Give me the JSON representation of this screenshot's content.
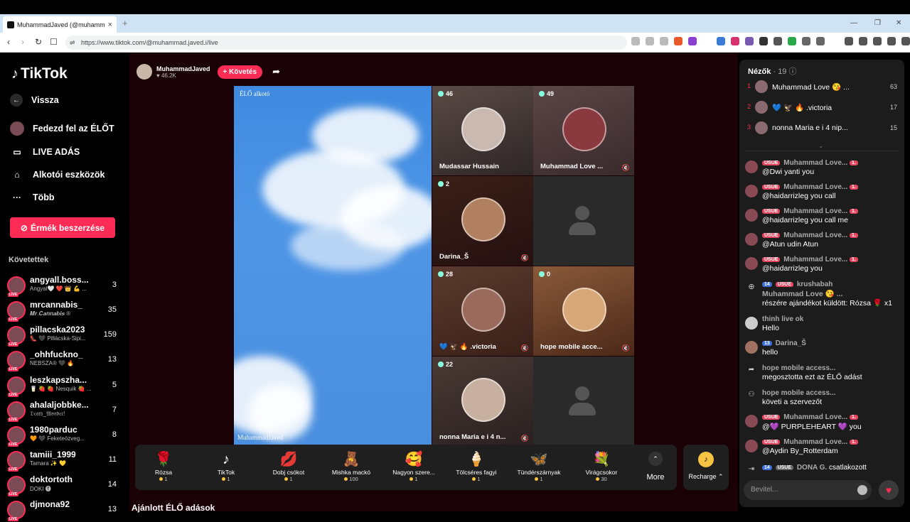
{
  "browser": {
    "tab_title": "MuhammadJaved (@muhamm",
    "url": "https://www.tiktok.com/@muhammad.javed.i/live"
  },
  "sidebar": {
    "logo": "TikTok",
    "back": "Vissza",
    "discover_live": "Fedezd fel az ÉLŐT",
    "live_stream": "LIVE ADÁS",
    "creator_tools": "Alkotói eszközök",
    "more": "Több",
    "buy_coins": "Érmék beszerzése",
    "followed_title": "Követettek",
    "followed": [
      {
        "name": "angyall.boss...",
        "sub": "Angyal🤍 ❤️ 👑 💪 ...",
        "count": "3"
      },
      {
        "name": "mrcannabis_",
        "sub": "𝑴𝒓.𝑪𝒂𝒏𝒏𝒂𝒃𝒊𝒔 ®",
        "count": "35"
      },
      {
        "name": "pillacska2023",
        "sub": "👠 🖤 Pillácska-Sipi...",
        "count": "159"
      },
      {
        "name": "_ohhfuckno_",
        "sub": "NEBSZA® 🖤 🔥",
        "count": "13"
      },
      {
        "name": "leszkapszha...",
        "sub": "🥛 🍓 🍓 Nesquik 🍓 ...",
        "count": "5"
      },
      {
        "name": "ahalaljobbke...",
        "sub": "𝔇𝔢𝔞𝔱𝔥_𝔚𝔬𝔫𝔡𝔢𝔯!",
        "count": "7"
      },
      {
        "name": "1980parduc",
        "sub": "🧡 🖤 Feketeözveg...",
        "count": "8"
      },
      {
        "name": "tamiii_1999",
        "sub": "Tamara ✨ 💛",
        "count": "11"
      },
      {
        "name": "doktortoth",
        "sub": "DOKI 🅣",
        "count": "14"
      },
      {
        "name": "djmona92",
        "sub": "",
        "count": "13"
      }
    ]
  },
  "host": {
    "name": "MuhammadJaved",
    "likes": "46.2K",
    "follow_label": "+ Követés"
  },
  "stage": {
    "creator_label": "ÉLŐ alkotó",
    "host_label": "MuhammadJaved",
    "guests": [
      {
        "name": "Mudassar Hussain",
        "count": "46"
      },
      {
        "name": "Muhammad Love ...",
        "count": "49"
      },
      {
        "name": "Darina_Š",
        "count": "2"
      },
      {
        "name": "",
        "count": ""
      },
      {
        "name": "💙 🦅 🔥 .victoria",
        "count": "28"
      },
      {
        "name": "hope mobile acce...",
        "count": "0"
      },
      {
        "name": "nonna Maria e i 4 n...",
        "count": "22"
      },
      {
        "name": "",
        "count": ""
      }
    ]
  },
  "gifts": [
    {
      "icon": "🌹",
      "name": "Rózsa",
      "price": "1"
    },
    {
      "icon": "♪",
      "name": "TikTok",
      "price": "1"
    },
    {
      "icon": "💋",
      "name": "Dobj csókot",
      "price": "1"
    },
    {
      "icon": "🧸",
      "name": "Mishka mackó",
      "price": "100"
    },
    {
      "icon": "🥰",
      "name": "Nagyon szere...",
      "price": "1"
    },
    {
      "icon": "🍦",
      "name": "Tölcséres fagyi",
      "price": "1"
    },
    {
      "icon": "🦋",
      "name": "Tündérszárnyak",
      "price": "1"
    },
    {
      "icon": "💐",
      "name": "Virágcsokor",
      "price": "30"
    }
  ],
  "more_label": "More",
  "recharge_label": "Recharge",
  "recommended_title": "Ajánlott ÉLŐ adások",
  "viewers": {
    "title": "Nézők",
    "count": "· 19",
    "top": [
      {
        "rank": "1",
        "name": "Muhammad Love 😘 ...",
        "score": "63"
      },
      {
        "rank": "2",
        "name": "💙 🦅 🔥 .victoria",
        "score": "17"
      },
      {
        "rank": "3",
        "name": "nonna Maria e i 4 nip...",
        "score": "15"
      }
    ]
  },
  "chat": [
    {
      "user": "Muhammad Love...",
      "text": "@Dwi yanti you"
    },
    {
      "user": "Muhammad Love...",
      "text": "@haidarrizleg you call"
    },
    {
      "user": "Muhammad Love...",
      "text": "@haidarrizleg you call me"
    },
    {
      "user": "Muhammad Love...",
      "text": "@Atun udin Atun"
    },
    {
      "user": "Muhammad Love...",
      "text": "@haidarrizleg you"
    },
    {
      "user": "krushabah",
      "text": "Muhammad Love 😘 ...",
      "text2": "részére ajándékot küldött: Rózsa 🌹 x1"
    },
    {
      "user": "thinh live ok",
      "text": "Hello"
    },
    {
      "user": "Darina_Š",
      "text": "hello"
    },
    {
      "user": "hope mobile access...",
      "text": "megosztotta ezt az ÉLŐ adást"
    },
    {
      "user": "hope mobile access...",
      "text": "követi a szervezőt"
    },
    {
      "user": "Muhammad Love...",
      "text": "@💜 PURPLEHEART 💜 you"
    },
    {
      "user": "Muhammad Love...",
      "text": "@Aydin By_Rotterdam"
    },
    {
      "user": "DONA G.",
      "text": "csatlakozott"
    }
  ],
  "badges": {
    "usue": "USUE",
    "level14": "14",
    "level13": "13",
    "one": "1."
  },
  "input_placeholder": "Bevitel..."
}
